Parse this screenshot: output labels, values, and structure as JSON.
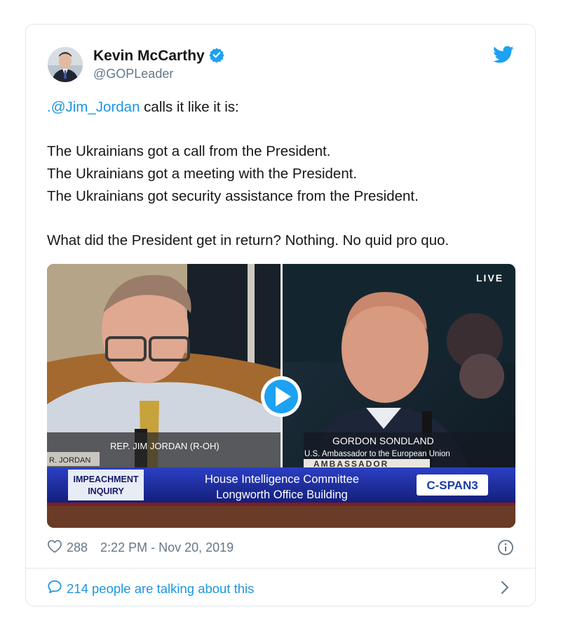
{
  "author": {
    "name": "Kevin McCarthy",
    "handle": "@GOPLeader"
  },
  "tweet": {
    "mention": ".@Jim_Jordan",
    "line1_rest": " calls it like it is:",
    "line2": "The Ukrainians got a call from the President.",
    "line3": "The Ukrainians got a meeting with the President.",
    "line4": "The Ukrainians got security assistance from the President.",
    "line5": "What did the President get in return? Nothing. No quid pro quo."
  },
  "video": {
    "live_label": "LIVE",
    "left_chyron": "REP. JIM JORDAN (R-OH)",
    "left_nameplate": "R. JORDAN",
    "right_name": "GORDON SONDLAND",
    "right_title": "U.S. Ambassador to the European Union",
    "right_nameplate": "AMBASSADOR",
    "program_tag_line1": "IMPEACHMENT",
    "program_tag_line2": "INQUIRY",
    "program_line1": "House Intelligence Committee",
    "program_line2": "Longworth Office Building",
    "network_logo": "C-SPAN3"
  },
  "stats": {
    "likes": "288",
    "timestamp": "2:22 PM - Nov 20, 2019"
  },
  "footer": {
    "talking": "214 people are talking about this"
  },
  "icons": {
    "verified": "verified-badge-icon",
    "twitter": "twitter-bird-icon",
    "like": "heart-icon",
    "info": "info-icon",
    "comment": "speech-bubble-icon",
    "chevron": "chevron-right-icon",
    "play": "play-icon"
  },
  "colors": {
    "link": "#1b95e0",
    "secondary_text": "#657786",
    "border": "#e1e8ed",
    "chyron_blue": "#1a2a9a",
    "verified": "#1da1f2"
  }
}
